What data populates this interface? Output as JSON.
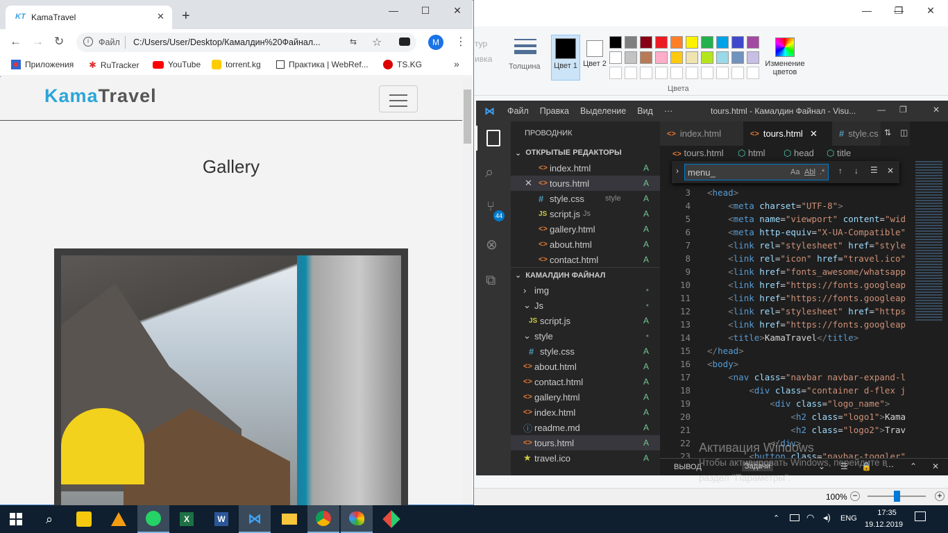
{
  "chrome": {
    "tab_title": "KamaTravel",
    "tab_logo": "KT",
    "omni_label": "Файл",
    "url": "C:/Users/User/Desktop/Камалдин%20Файнал...",
    "profile_letter": "M",
    "bookmarks": [
      {
        "label": "Приложения",
        "icon": "apps-icon"
      },
      {
        "label": "RuTracker",
        "icon": "rutracker-icon"
      },
      {
        "label": "YouTube",
        "icon": "youtube-icon"
      },
      {
        "label": "torrent.kg",
        "icon": "torrentkg-icon"
      },
      {
        "label": "Практика | WebRef...",
        "icon": "webref-icon"
      },
      {
        "label": "TS.KG",
        "icon": "tskg-icon"
      }
    ],
    "more_bookmarks": "»"
  },
  "site": {
    "logo_part1": "Kama",
    "logo_part2": "Travel",
    "gallery_title": "Gallery"
  },
  "paint": {
    "thickness_label": "Толщина",
    "color1_label": "Цвет 1",
    "color2_label": "Цвет 2",
    "edit_colors_label": "Изменение цветов",
    "colors_group_label": "Цвета",
    "partial1": "тур",
    "partial2": "ивка",
    "zoom": "100%",
    "palette_row1": [
      "#000000",
      "#7f7f7f",
      "#880015",
      "#ed1c24",
      "#ff7f27",
      "#fff200",
      "#22b14c",
      "#00a2e8",
      "#3f48cc",
      "#a349a4"
    ],
    "palette_row2": [
      "#ffffff",
      "#c3c3c3",
      "#b97a57",
      "#ffaec9",
      "#ffc90e",
      "#efe4b0",
      "#b5e61d",
      "#99d9ea",
      "#7092be",
      "#c8bfe7"
    ]
  },
  "vscode": {
    "menu": [
      "Файл",
      "Правка",
      "Выделение",
      "Вид",
      "···"
    ],
    "window_title": "tours.html - Камалдин Файнал - Visu...",
    "explorer_title": "ПРОВОДНИК",
    "open_editors_title": "ОТКРЫТЫЕ РЕДАКТОРЫ",
    "open_editors": [
      {
        "name": "index.html",
        "type": "html",
        "status": "A",
        "hint": ""
      },
      {
        "name": "tours.html",
        "type": "html",
        "status": "A",
        "hint": ""
      },
      {
        "name": "style.css",
        "type": "css",
        "status": "A",
        "hint": "style"
      },
      {
        "name": "script.js",
        "type": "js",
        "status": "A",
        "hint": "Js"
      },
      {
        "name": "gallery.html",
        "type": "html",
        "status": "A",
        "hint": ""
      },
      {
        "name": "about.html",
        "type": "html",
        "status": "A",
        "hint": ""
      },
      {
        "name": "contact.html",
        "type": "html",
        "status": "A",
        "hint": ""
      }
    ],
    "folder_title": "КАМАЛДИН ФАЙНАЛ",
    "tree": [
      {
        "name": "img",
        "kind": "folder-closed",
        "level": 1,
        "status": "•"
      },
      {
        "name": "Js",
        "kind": "folder-open",
        "level": 1,
        "status": "•"
      },
      {
        "name": "script.js",
        "kind": "js",
        "level": 2,
        "status": "A"
      },
      {
        "name": "style",
        "kind": "folder-open",
        "level": 1,
        "status": "•"
      },
      {
        "name": "style.css",
        "kind": "css",
        "level": 2,
        "status": "A"
      },
      {
        "name": "about.html",
        "kind": "html",
        "level": 1,
        "status": "A"
      },
      {
        "name": "contact.html",
        "kind": "html",
        "level": 1,
        "status": "A"
      },
      {
        "name": "gallery.html",
        "kind": "html",
        "level": 1,
        "status": "A"
      },
      {
        "name": "index.html",
        "kind": "html",
        "level": 1,
        "status": "A"
      },
      {
        "name": "readme.md",
        "kind": "md",
        "level": 1,
        "status": "A"
      },
      {
        "name": "tours.html",
        "kind": "html",
        "level": 1,
        "status": "A"
      },
      {
        "name": "travel.ico",
        "kind": "ico",
        "level": 1,
        "status": "A"
      }
    ],
    "tabs": [
      {
        "name": "index.html",
        "type": "html"
      },
      {
        "name": "tours.html",
        "type": "html"
      },
      {
        "name": "style.cs",
        "type": "css"
      }
    ],
    "breadcrumb": [
      "tours.html",
      "html",
      "head",
      "title"
    ],
    "find_query": "menu_",
    "find_opts": [
      "Aa",
      "Abl",
      ".*"
    ],
    "scm_badge": "44",
    "line_numbers": [
      "3",
      "4",
      "5",
      "6",
      "7",
      "8",
      "9",
      "10",
      "11",
      "12",
      "13",
      "14",
      "15",
      "16",
      "17",
      "18",
      "19",
      "20",
      "21",
      "22",
      "23"
    ],
    "code_lines": [
      "<head>",
      "    <meta charset=\"UTF-8\">",
      "    <meta name=\"viewport\" content=\"wid",
      "    <meta http-equiv=\"X-UA-Compatible\"",
      "    <link rel=\"stylesheet\" href=\"style",
      "    <link rel=\"icon\" href=\"travel.ico\"",
      "    <link href=\"fonts_awesome/whatsapp",
      "    <link href=\"https://fonts.googleap",
      "    <link href=\"https://fonts.googleap",
      "    <link rel=\"stylesheet\" href=\"https",
      "    <link href=\"https://fonts.googleap",
      "    <title>KamaTravel</title>",
      "</head>",
      "<body>",
      "    <nav class=\"navbar navbar-expand-l",
      "        <div class=\"container d-flex j",
      "            <div class=\"logo_name\">",
      "                <h2 class=\"logo1\">Kama",
      "                <h2 class=\"logo2\">Trav",
      "            </div>",
      "        <button class=\"navbar-toggler\" t"
    ],
    "panel_tabs": [
      "ВЫВОД",
      "Задачи"
    ],
    "activation_title": "Активация Windows",
    "activation_sub1": "Чтобы активировать Windows, перейдите в",
    "activation_sub2": "раздел \"Параметры\"."
  },
  "taskbar": {
    "apps": [
      "search-icon",
      "playpc-icon",
      "avast-icon",
      "whatsapp-icon",
      "excel-icon",
      "word-icon",
      "vscode-icon",
      "explorer-icon",
      "chrome-icon",
      "paint-icon",
      "git-icon"
    ],
    "lang": "ENG",
    "time": "17:35",
    "date": "19.12.2019"
  }
}
